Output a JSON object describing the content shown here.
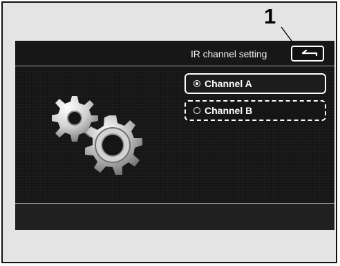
{
  "callout": {
    "number": "1"
  },
  "screen": {
    "title": "IR channel setting",
    "back_icon": "back-arrow-icon",
    "graphic_icon": "gears-icon"
  },
  "channels": {
    "a_label": "Channel A",
    "b_label": "Channel B"
  },
  "colors": {
    "screen_background": "#151515",
    "frame_background": "#e4e4e4",
    "option_border": "#ffffff"
  }
}
